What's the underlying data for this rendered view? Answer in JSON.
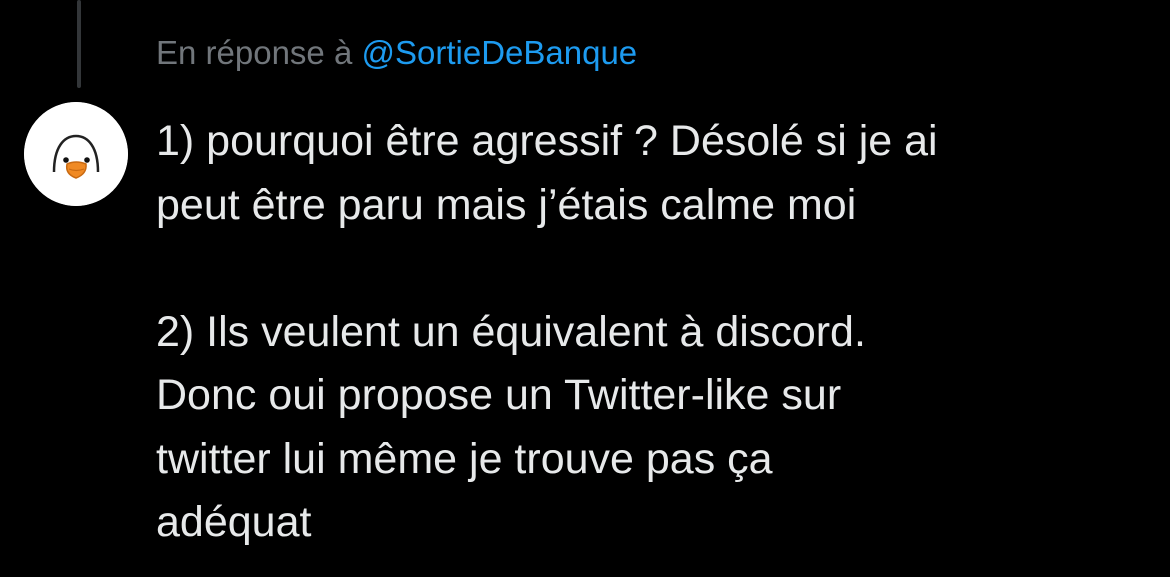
{
  "reply_header": {
    "prefix": "En réponse à ",
    "handle": "@SortieDeBanque"
  },
  "author": {
    "avatar_icon": "duck-avatar-icon"
  },
  "tweet": {
    "paragraph1": [
      "1) pourquoi être agressif ? Désolé si je ai",
      "peut être paru mais j’étais calme moi"
    ],
    "paragraph2": [
      "2) Ils veulent un équivalent à discord.",
      "Donc oui propose un Twitter-like sur",
      "twitter lui même je trouve pas ça",
      "adéquat"
    ]
  },
  "colors": {
    "background": "#000000",
    "text": "#e7e9ea",
    "muted": "#71767b",
    "link": "#1d9bf0",
    "thread_line": "#333639"
  }
}
